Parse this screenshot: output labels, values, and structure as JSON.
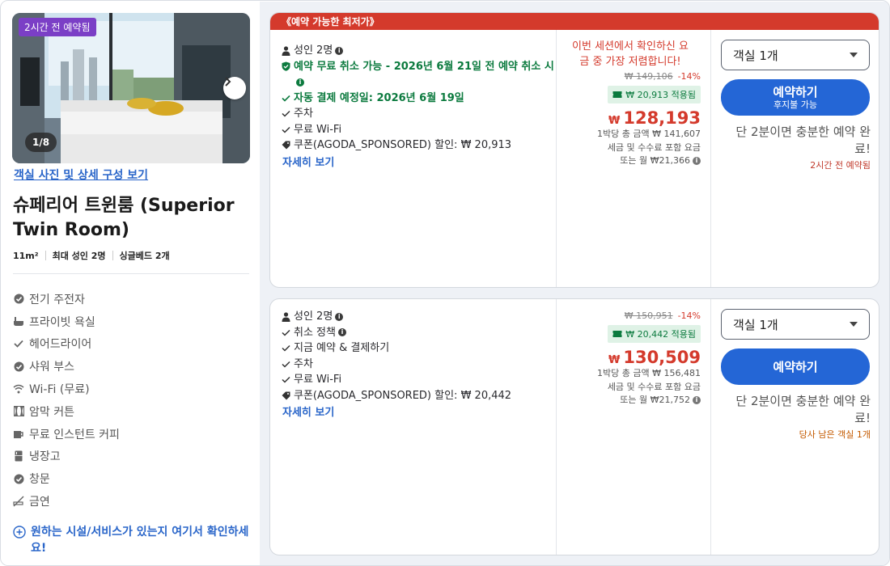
{
  "room": {
    "time_badge": "2시간 전 예약됨",
    "photo_counter": "1/8",
    "photo_link": "객실 사진 및 상세 구성 보기",
    "title": "슈페리어 트윈룸 (Superior Twin Room)",
    "specs": [
      "11m²",
      "최대 성인 2명",
      "싱글베드 2개"
    ],
    "amenities": [
      {
        "icon": "check-circle-icon",
        "label": "전기 주전자"
      },
      {
        "icon": "bath-icon",
        "label": "프라이빗 욕실"
      },
      {
        "icon": "check-icon",
        "label": "헤어드라이어"
      },
      {
        "icon": "check-circle-icon",
        "label": "샤워 부스"
      },
      {
        "icon": "wifi-icon",
        "label": "Wi-Fi (무료)"
      },
      {
        "icon": "curtain-icon",
        "label": "암막 커튼"
      },
      {
        "icon": "coffee-icon",
        "label": "무료 인스턴트 커피"
      },
      {
        "icon": "fridge-icon",
        "label": "냉장고"
      },
      {
        "icon": "check-circle-icon",
        "label": "창문"
      },
      {
        "icon": "no-smoking-icon",
        "label": "금연"
      }
    ],
    "ask_link": "원하는 시설/서비스가 있는지 여기서 확인하세요!"
  },
  "offers": [
    {
      "banner": "《예약 가능한 최저가》",
      "features": [
        {
          "icon": "person-icon",
          "text": "성인 2명",
          "info": true,
          "style": "normal"
        },
        {
          "icon": "shield-check-icon",
          "text": "예약 무료 취소 가능 - 2026년 6월 21일 전 예약 취소 시",
          "info": true,
          "style": "green"
        },
        {
          "icon": "check-icon",
          "text": "자동 결제 예정일: 2026년 6월 19일",
          "info": false,
          "style": "green"
        },
        {
          "icon": "check-icon",
          "text": "주차",
          "info": false,
          "style": "normal"
        },
        {
          "icon": "check-icon",
          "text": "무료 Wi-Fi",
          "info": false,
          "style": "normal"
        },
        {
          "icon": "tag-icon",
          "text": "쿠폰(AGODA_SPONSORED) 할인: ₩ 20,913",
          "info": false,
          "style": "normal"
        }
      ],
      "details_link": "자세히 보기",
      "promo": "이번 세션에서 확인하신 요금 중 가장 저렴합니다!",
      "original_price": "₩ 149,106",
      "discount": "-14%",
      "coupon_applied": "₩ 20,913 적용됨",
      "currency": "₩",
      "price": "128,193",
      "per_night_total": "1박당 총 금액 ₩ 141,607",
      "tax_note": "세금 및 수수료 포함 요금",
      "monthly": "또는 월 ₩21,366",
      "room_select": "객실 1개",
      "book_label": "예약하기",
      "book_sub": "후지불 가능",
      "urgency": "단 2분이면 충분한 예약 완료!",
      "urgency_sub": "2시간 전 예약됨"
    },
    {
      "features": [
        {
          "icon": "person-icon",
          "text": "성인 2명",
          "info": true,
          "style": "normal"
        },
        {
          "icon": "check-icon",
          "text": "취소 정책",
          "info": true,
          "style": "normal"
        },
        {
          "icon": "check-icon",
          "text": "지금 예약 & 결제하기",
          "info": false,
          "style": "normal"
        },
        {
          "icon": "check-icon",
          "text": "주차",
          "info": false,
          "style": "normal"
        },
        {
          "icon": "check-icon",
          "text": "무료 Wi-Fi",
          "info": false,
          "style": "normal"
        },
        {
          "icon": "tag-icon",
          "text": "쿠폰(AGODA_SPONSORED) 할인: ₩ 20,442",
          "info": false,
          "style": "normal"
        }
      ],
      "details_link": "자세히 보기",
      "original_price": "₩ 150,951",
      "discount": "-14%",
      "coupon_applied": "₩ 20,442 적용됨",
      "currency": "₩",
      "price": "130,509",
      "per_night_total": "1박당 총 금액 ₩ 156,481",
      "tax_note": "세금 및 수수료 포함 요금",
      "monthly": "또는 월 ₩21,752",
      "room_select": "객실 1개",
      "book_label": "예약하기",
      "urgency": "단 2분이면 충분한 예약 완료!",
      "urgency_sub": "당사 남은 객실 1개"
    }
  ],
  "colors": {
    "accent_blue": "#2466d6",
    "deal_red": "#d43a2c",
    "green": "#0b7a3e",
    "badge_purple": "#7b3fc6"
  }
}
